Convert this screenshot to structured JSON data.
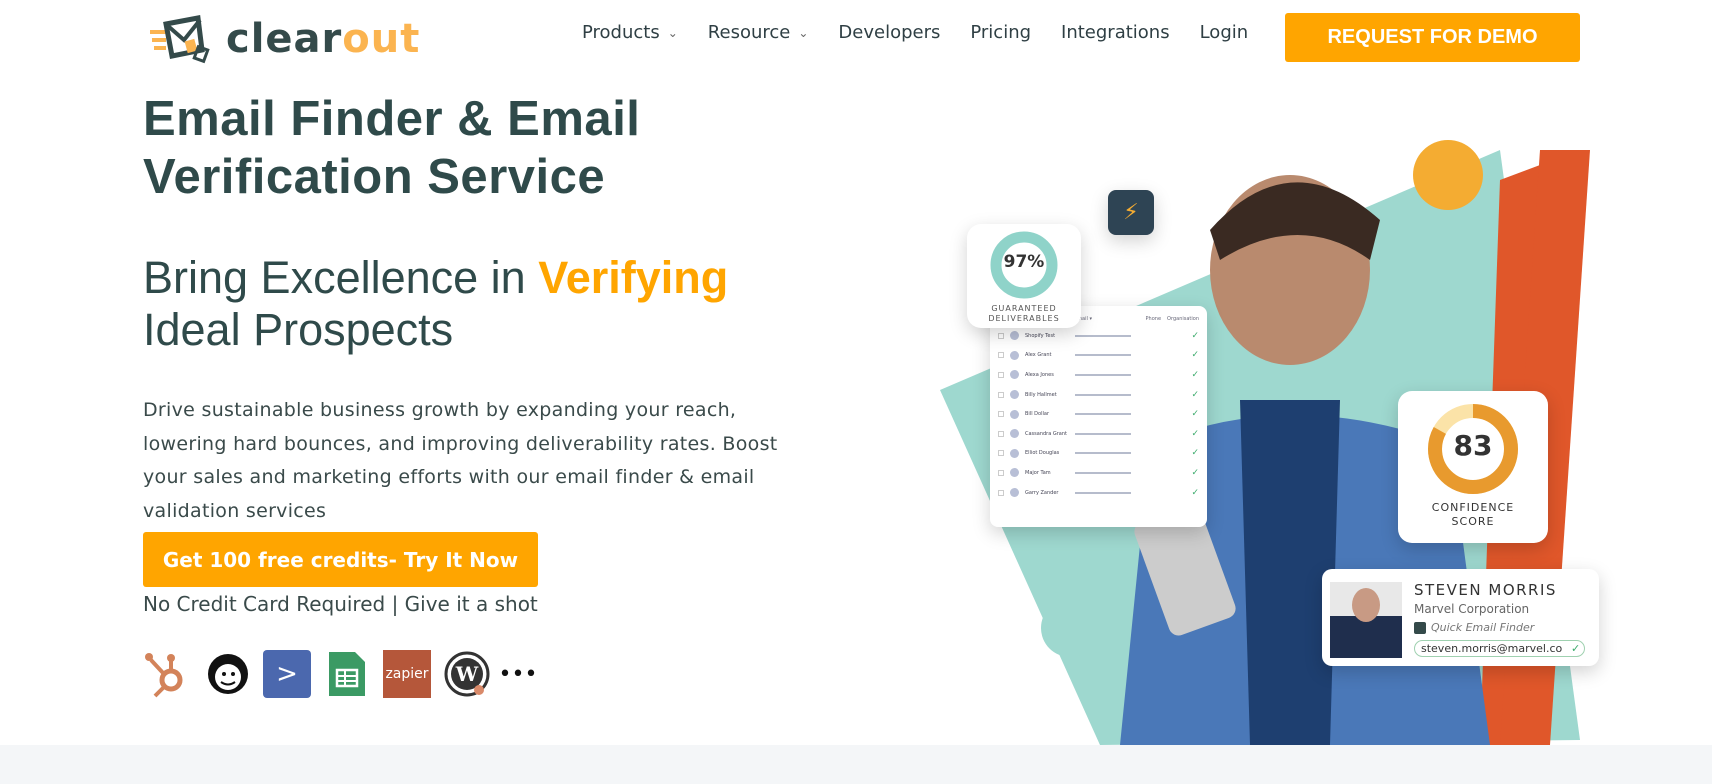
{
  "logo": {
    "text_dark": "clear",
    "text_accent": "out"
  },
  "nav": {
    "items": [
      {
        "label": "Products",
        "dropdown": true
      },
      {
        "label": "Resource",
        "dropdown": true
      },
      {
        "label": "Developers"
      },
      {
        "label": "Pricing"
      },
      {
        "label": "Integrations"
      },
      {
        "label": "Login"
      }
    ],
    "demo_button": "REQUEST FOR DEMO"
  },
  "hero": {
    "title_line1": "Email Finder & Email",
    "title_line2": "Verification Service",
    "subtitle_pre": "Bring Excellence in ",
    "subtitle_highlight": "Verifying",
    "subtitle_line2": "Ideal Prospects",
    "description": "Drive sustainable business growth by expanding your reach, lowering hard bounces, and improving deliverability rates. Boost your sales and marketing efforts with our email finder & email validation services",
    "cta": "Get 100 free credits- Try It Now",
    "note": "No Credit Card Required | Give it a shot"
  },
  "integrations": [
    {
      "name": "hubspot-icon"
    },
    {
      "name": "mailchimp-icon"
    },
    {
      "name": "activecampaign-icon"
    },
    {
      "name": "google-sheets-icon"
    },
    {
      "name": "zapier-icon",
      "label": "zapier"
    },
    {
      "name": "wordpress-icon"
    },
    {
      "name": "more-icon",
      "label": "•••"
    }
  ],
  "visual": {
    "deliverables": {
      "value": "97%",
      "label1": "GUARANTEED",
      "label2": "DELIVERABLES",
      "percent": 97
    },
    "table": {
      "headers": [
        "Email ▾",
        "Phone",
        "Organisation"
      ],
      "rows": [
        "Shopify Test",
        "Alex Grant",
        "Alexa Jones",
        "Billy Hallmet",
        "Bill Dollar",
        "Cassandra Grant",
        "Elliot Douglas",
        "Major Tam",
        "Garry Zander"
      ]
    },
    "confidence": {
      "value": "83",
      "label1": "CONFIDENCE",
      "label2": "SCORE",
      "percent": 83
    },
    "contact": {
      "name": "STEVEN MORRIS",
      "company": "Marvel Corporation",
      "tool": "Quick Email Finder",
      "email": "steven.morris@marvel.co"
    }
  },
  "colors": {
    "accent": "#ffa500",
    "dark": "#2f4a4a",
    "teal": "#8fd3c9",
    "orange_red": "#e0572a",
    "yellow": "#f4ac32"
  }
}
